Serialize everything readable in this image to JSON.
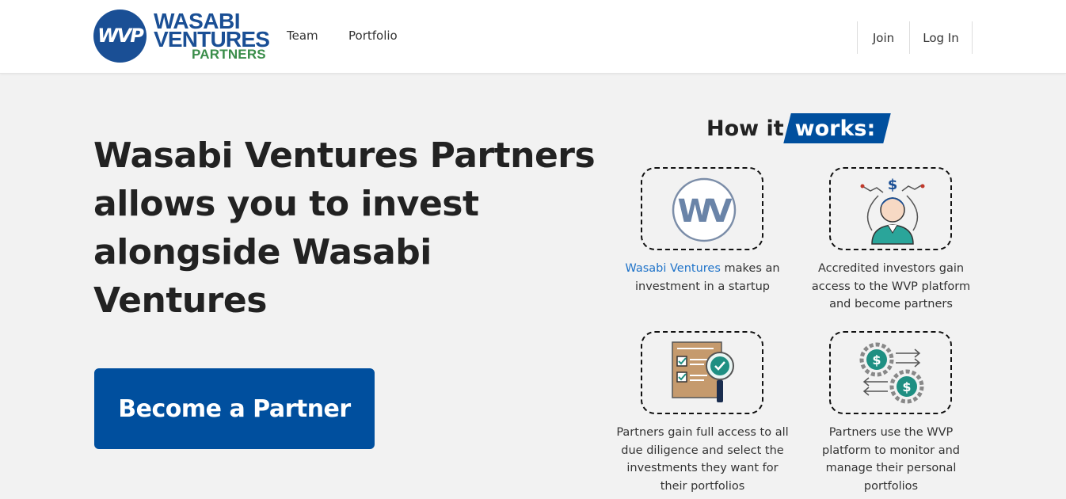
{
  "header": {
    "logo": {
      "monogram": "WVP",
      "line1": "WASABI",
      "line2": "VENTURES",
      "line3": "PARTNERS"
    },
    "nav": [
      {
        "label": "Team"
      },
      {
        "label": "Portfolio"
      }
    ],
    "auth": {
      "join_label": "Join",
      "login_label": "Log In"
    }
  },
  "hero": {
    "title": "Wasabi Ventures Partners allows you to invest alongside Wasabi Ventures",
    "cta_label": "Become a Partner"
  },
  "how_it_works": {
    "heading_plain": "How it",
    "heading_badge": "works:",
    "steps": [
      {
        "icon": "wv-logo-icon",
        "link_text": "Wasabi Ventures",
        "text": " makes an investment in a startup"
      },
      {
        "icon": "investor-icon",
        "text": "Accredited investors gain access to the WVP platform and become partners"
      },
      {
        "icon": "checklist-magnifier-icon",
        "text": "Partners gain full access to all due diligence and select the investments they want for their portfolios"
      },
      {
        "icon": "money-gears-icon",
        "text": "Partners use the WVP platform to monitor and manage their personal portfolios"
      }
    ]
  },
  "colors": {
    "brand_blue": "#004f9e",
    "logo_blue": "#1a4f95",
    "logo_green": "#3a8d4a",
    "link_blue": "#1f73c9",
    "page_bg": "#f2f2f2"
  }
}
